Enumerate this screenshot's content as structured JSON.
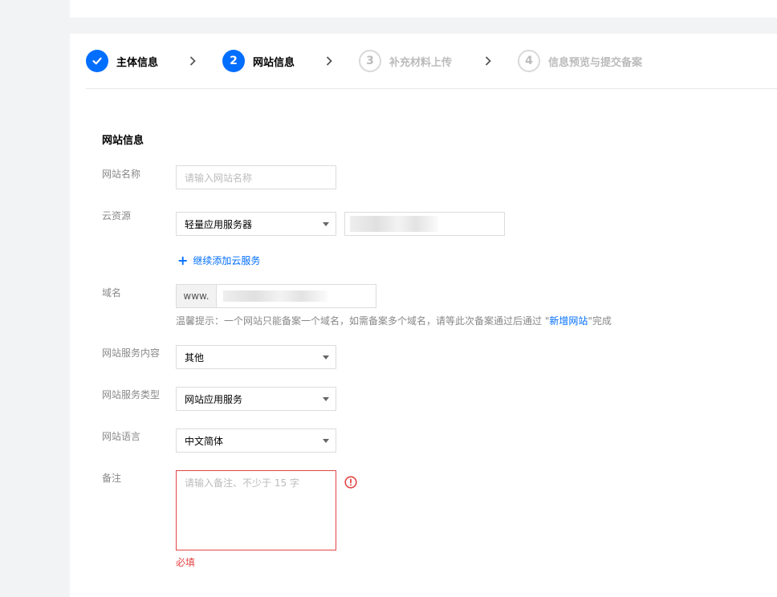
{
  "steps": [
    {
      "number": "",
      "label": "主体信息",
      "status": "done"
    },
    {
      "number": "2",
      "label": "网站信息",
      "status": "active"
    },
    {
      "number": "3",
      "label": "补充材料上传",
      "status": "pending"
    },
    {
      "number": "4",
      "label": "信息预览与提交备案",
      "status": "pending"
    }
  ],
  "section_title": "网站信息",
  "fields": {
    "site_name": {
      "label": "网站名称",
      "placeholder": "请输入网站名称",
      "value": ""
    },
    "cloud_resource": {
      "label": "云资源",
      "selected": "轻量应用服务器",
      "add_link": "继续添加云服务"
    },
    "domain": {
      "label": "域名",
      "prefix": "www.",
      "hint_prefix": "温馨提示：一个网站只能备案一个域名，如需备案多个域名，请等此次备案通过后通过 \"",
      "hint_link": "新增网站",
      "hint_suffix": "\"完成"
    },
    "service_content": {
      "label": "网站服务内容",
      "selected": "其他"
    },
    "service_type": {
      "label": "网站服务类型",
      "selected": "网站应用服务"
    },
    "language": {
      "label": "网站语言",
      "selected": "中文简体"
    },
    "remark": {
      "label": "备注",
      "placeholder": "请输入备注、不少于 15 字",
      "error": "必填"
    }
  },
  "colors": {
    "primary": "#006eff",
    "error": "#e54545",
    "pending": "#bbbbbb"
  },
  "icons": {
    "done_step": "check-icon",
    "separator": "chevron-right-icon",
    "error": "error-circle-icon"
  }
}
